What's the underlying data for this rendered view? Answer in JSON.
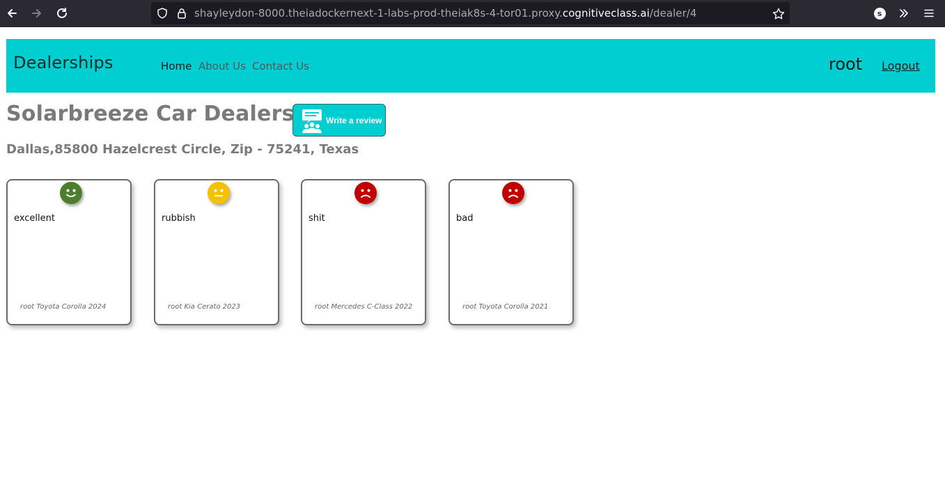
{
  "browser": {
    "url_prefix": "shayleydon-8000.theiadockernext-1-labs-prod-theiak8s-4-tor01.proxy.",
    "url_host": "cognitiveclass.ai",
    "url_path": "/dealer/4",
    "profile_initial": "s"
  },
  "navbar": {
    "brand": "Dealerships",
    "links": [
      "Home",
      "About Us",
      "Contact Us"
    ],
    "user": "root",
    "logout": "Logout",
    "color": "#00ced1"
  },
  "dealer": {
    "name": "Solarbreeze Car Dealership",
    "address": "Dallas,85800 Hazelcrest Circle, Zip - 75241, Texas"
  },
  "review_button": {
    "label": "Write a review"
  },
  "reviews": [
    {
      "text": "excellent",
      "meta": "root Toyota Corolla 2024",
      "sentiment": "positive",
      "color": "#4e7d2e"
    },
    {
      "text": "rubbish",
      "meta": "root Kia Cerato 2023",
      "sentiment": "neutral",
      "color": "#f2c200"
    },
    {
      "text": "shit",
      "meta": "root Mercedes C-Class 2022",
      "sentiment": "negative",
      "color": "#c00000"
    },
    {
      "text": "bad",
      "meta": "root Toyota Corolla 2021",
      "sentiment": "negative",
      "color": "#c00000"
    }
  ]
}
